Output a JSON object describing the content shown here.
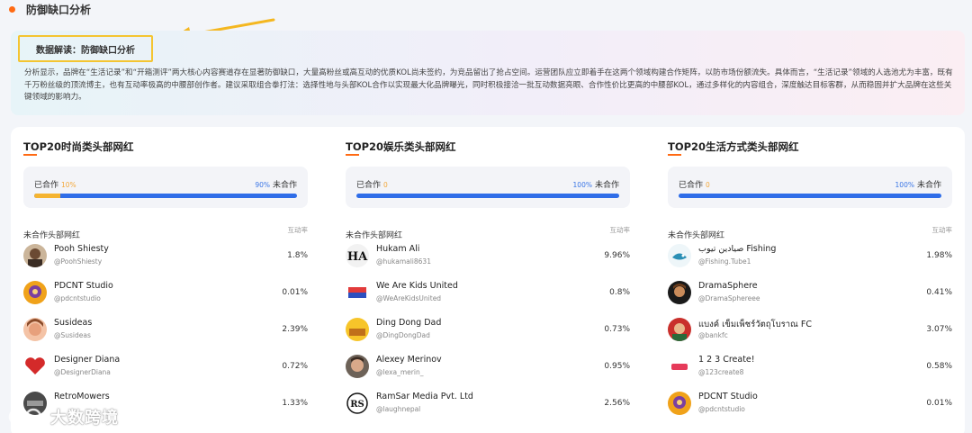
{
  "section": {
    "title": "防御缺口分析"
  },
  "summary": {
    "tag": "数据解读：防御缺口分析",
    "text": "分析显示，品牌在“生活记录”和“开箱测评”两大核心内容赛道存在显著防御缺口，大量高粉丝或高互动的优质KOL尚未签约，为竞品留出了抢占空间。运营团队应立即着手在这两个领域构建合作矩阵，以防市场份额流失。具体而言，“生活记录”领域的人选池尤为丰富，既有千万粉丝级的顶流博主，也有互动率极高的中腰部创作者。建议采取组合拳打法：选择性地与头部KOL合作以实现最大化品牌曝光，同时积极接洽一批互动数据亮眼、合作性价比更高的中腰部KOL，通过多样化的内容组合，深度触达目标客群，从而稳固并扩大品牌在这些关键领域的影响力。"
  },
  "columns": [
    {
      "title": "TOP20时尚类头部网红",
      "cooperated_label": "已合作",
      "cooperated_pct": "10%",
      "cooperated_fraction": 0.1,
      "uncooperated_label": "未合作",
      "uncooperated_pct": "90%",
      "list_label": "未合作头部网红",
      "rate_label": "互动率",
      "items": [
        {
          "name": "Pooh Shiesty",
          "handle": "@PoohShiesty",
          "rate": "1.8%"
        },
        {
          "name": "PDCNT Studio",
          "handle": "@pdcntstudio",
          "rate": "0.01%"
        },
        {
          "name": "Susideas",
          "handle": "@Susideas",
          "rate": "2.39%"
        },
        {
          "name": "Designer Diana",
          "handle": "@DesignerDiana",
          "rate": "0.72%"
        },
        {
          "name": "RetroMowers",
          "handle": "",
          "rate": "1.33%"
        }
      ]
    },
    {
      "title": "TOP20娱乐类头部网红",
      "cooperated_label": "已合作",
      "cooperated_pct": "0",
      "cooperated_fraction": 0,
      "uncooperated_label": "未合作",
      "uncooperated_pct": "100%",
      "list_label": "未合作头部网红",
      "rate_label": "互动率",
      "items": [
        {
          "name": "Hukam Ali",
          "handle": "@hukamali8631",
          "rate": "9.96%"
        },
        {
          "name": "We Are Kids United",
          "handle": "@WeAreKidsUnited",
          "rate": "0.8%"
        },
        {
          "name": "Ding Dong Dad",
          "handle": "@DingDongDad",
          "rate": "0.73%"
        },
        {
          "name": "Alexey Merinov",
          "handle": "@lexa_merin_",
          "rate": "0.95%"
        },
        {
          "name": "RamSar Media Pvt. Ltd",
          "handle": "@laughnepal",
          "rate": "2.56%"
        }
      ]
    },
    {
      "title": "TOP20生活方式类头部网红",
      "cooperated_label": "已合作",
      "cooperated_pct": "0",
      "cooperated_fraction": 0,
      "uncooperated_label": "未合作",
      "uncooperated_pct": "100%",
      "list_label": "未合作头部网红",
      "rate_label": "互动率",
      "items": [
        {
          "name": "صيادين تيوب Fishing",
          "handle": "@Fishing.Tube1",
          "rate": "1.98%"
        },
        {
          "name": "DramaSphere",
          "handle": "@DramaSphereee",
          "rate": "0.41%"
        },
        {
          "name": "แบงค์ เข็มเพ็ชร์วัตถุโบราณ FC",
          "handle": "@bankfc",
          "rate": "3.07%"
        },
        {
          "name": "1 2 3 Create!",
          "handle": "@123create8",
          "rate": "0.58%"
        },
        {
          "name": "PDCNT Studio",
          "handle": "@pdcntstudio",
          "rate": "0.01%"
        }
      ]
    }
  ],
  "watermark": {
    "text": "大数跨境"
  },
  "colors": {
    "accent": "#ff6a13",
    "cooperated": "#f5b431",
    "uncooperated": "#2f6de8",
    "highlight": "#f4c531"
  }
}
